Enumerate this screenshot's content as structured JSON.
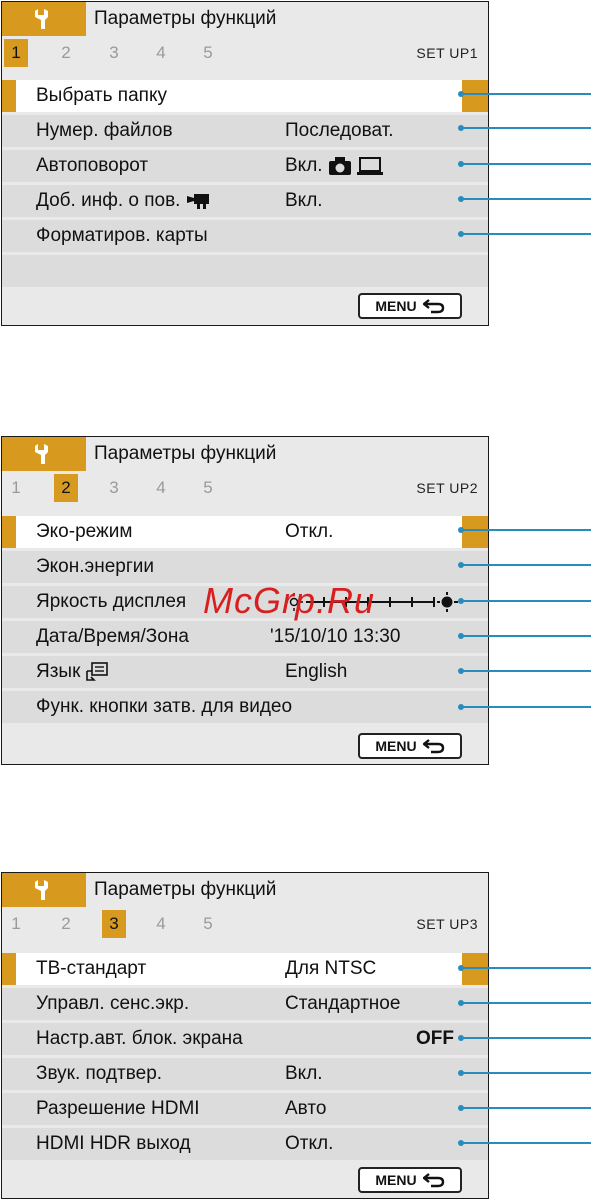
{
  "screens": [
    {
      "header_title": "Параметры функций",
      "tabs": [
        "1",
        "2",
        "3",
        "4",
        "5"
      ],
      "active_tab": "1",
      "set_label": "SET UP1",
      "items": [
        {
          "label": "Выбрать папку",
          "value": ""
        },
        {
          "label": "Нумер. файлов",
          "value": "Последоват."
        },
        {
          "label": "Автоповорот",
          "value": "Вкл."
        },
        {
          "label": "Доб. инф. о пов.",
          "value": "Вкл."
        },
        {
          "label": "Форматиров. карты",
          "value": ""
        }
      ],
      "menu_label": "MENU"
    },
    {
      "header_title": "Параметры функций",
      "tabs": [
        "1",
        "2",
        "3",
        "4",
        "5"
      ],
      "active_tab": "2",
      "set_label": "SET UP2",
      "items": [
        {
          "label": "Эко-режим",
          "value": "Откл."
        },
        {
          "label": "Экон.энергии",
          "value": ""
        },
        {
          "label": "Яркость дисплея",
          "value": ""
        },
        {
          "label": "Дата/Время/Зона",
          "value": "'15/10/10 13:30"
        },
        {
          "label": "Язык",
          "value": "English"
        },
        {
          "label": "Функ. кнопки затв. для видео",
          "value": ""
        }
      ],
      "menu_label": "MENU"
    },
    {
      "header_title": "Параметры функций",
      "tabs": [
        "1",
        "2",
        "3",
        "4",
        "5"
      ],
      "active_tab": "3",
      "set_label": "SET UP3",
      "items": [
        {
          "label": "ТВ-стандарт",
          "value": "Для NTSC"
        },
        {
          "label": "Управл. сенс.экр.",
          "value": "Стандартное"
        },
        {
          "label": "Настр.авт. блок. экрана",
          "value": "OFF"
        },
        {
          "label": "Звук. подтвер.",
          "value": "Вкл."
        },
        {
          "label": "Разрешение HDMI",
          "value": "Авто"
        },
        {
          "label": "HDMI HDR выход",
          "value": "Откл."
        }
      ],
      "menu_label": "MENU"
    }
  ],
  "watermark": "McGrp.Ru",
  "colors": {
    "accent": "#d79a1f",
    "callout": "#2a8bbf",
    "watermark": "#d81f1f"
  }
}
